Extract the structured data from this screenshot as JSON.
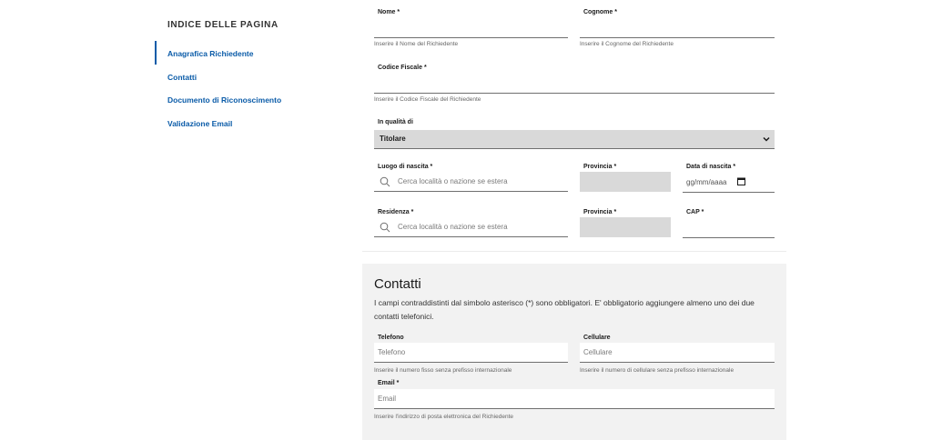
{
  "toc": {
    "title": "INDICE DELLE PAGINA",
    "items": [
      {
        "label": "Anagrafica Richiedente"
      },
      {
        "label": "Contatti"
      },
      {
        "label": "Documento di Riconoscimento"
      },
      {
        "label": "Validazione Email"
      }
    ]
  },
  "anagrafica": {
    "nome": {
      "label": "Nome *",
      "hint": "Inserire il Nome del Richiedente"
    },
    "cognome": {
      "label": "Cognome *",
      "hint": "Inserire il Cognome del Richiedente"
    },
    "codice_fiscale": {
      "label": "Codice Fiscale *",
      "hint": "Inserire il Codice Fiscale del Richiedente"
    },
    "qualita": {
      "label": "In qualità di",
      "value": "Titolare"
    },
    "luogo_nascita": {
      "label": "Luogo di nascita *",
      "placeholder": "Cerca località o nazione se estera"
    },
    "provincia_nascita": {
      "label": "Provincia *"
    },
    "data_nascita": {
      "label": "Data di nascita *",
      "placeholder": "gg/mm/aaaa"
    },
    "residenza": {
      "label": "Residenza *",
      "placeholder": "Cerca località o nazione se estera"
    },
    "provincia_residenza": {
      "label": "Provincia *"
    },
    "cap": {
      "label": "CAP *"
    }
  },
  "contatti": {
    "title": "Contatti",
    "description": "I campi contraddistinti dal simbolo asterisco (*) sono obbligatori. E' obbligatorio aggiungere almeno uno dei due contatti telefonici.",
    "telefono": {
      "label": "Telefono",
      "placeholder": "Telefono",
      "hint": "Inserire il numero fisso senza prefisso internazionale"
    },
    "cellulare": {
      "label": "Cellulare",
      "placeholder": "Cellulare",
      "hint": "Inserire il numero di cellulare senza prefisso internazionale"
    },
    "email": {
      "label": "Email *",
      "placeholder": "Email",
      "hint": "Inserire l'indirizzo di posta elettronica del Richiedente"
    }
  }
}
